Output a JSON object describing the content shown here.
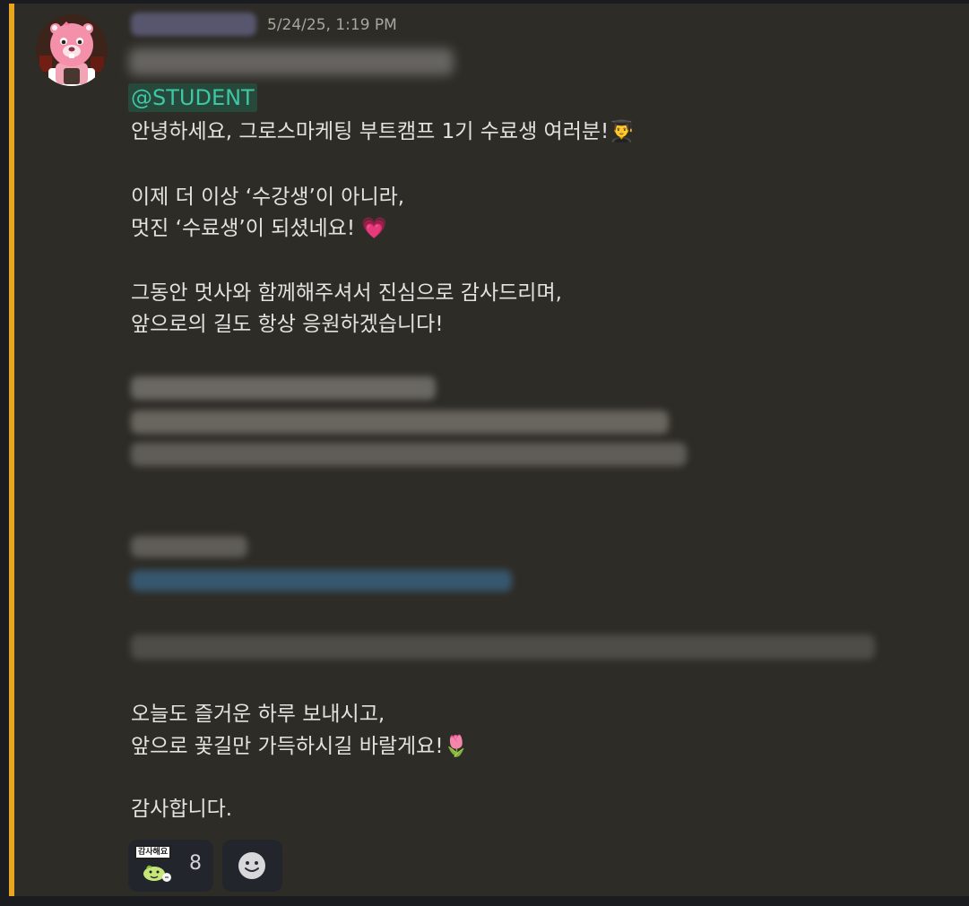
{
  "message": {
    "timestamp": "5/24/25, 1:19 PM",
    "mention": "@STUDENT",
    "lines": [
      "안녕하세요, 그로스마케팅 부트캠프 1기 수료생 여러분!👨‍🎓",
      "이제 더 이상 ‘수강생’이 아니라,",
      "멋진 ‘수료생’이 되셨네요! 💗",
      "그동안 멋사와 함께해주셔서 진심으로 감사드리며,",
      "앞으로의 길도 항상 응원하겠습니다!",
      "오늘도 즐거운 하루 보내시고,",
      "앞으로 꽃길만 가득하시길 바랄게요!🌷",
      "감사합니다."
    ]
  },
  "reaction": {
    "sticker_text": "감사해요",
    "count": "8"
  },
  "colors": {
    "accent_bar": "#e8a520",
    "message_bg": "#2e2c27",
    "mention_text": "#3fc6a4",
    "mention_bg": "#26493c"
  },
  "icons": {
    "avatar": "pink-beaver-avatar",
    "reaction": "thank-you-sticker",
    "add_reaction": "smile-icon"
  }
}
